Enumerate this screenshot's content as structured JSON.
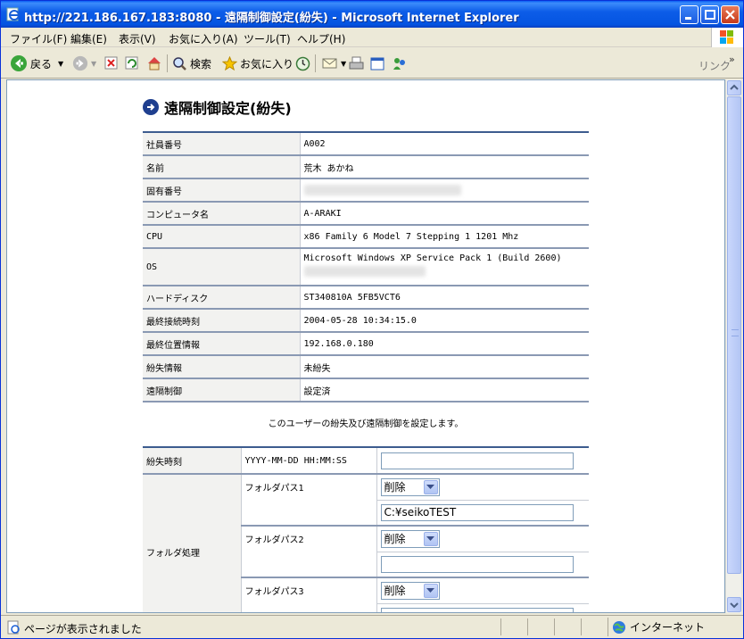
{
  "window": {
    "title": "http://221.186.167.183:8080 - 遠隔制御設定(紛失) - Microsoft Internet Explorer"
  },
  "menu": {
    "items": [
      "ファイル(F)",
      "編集(E)",
      "表示(V)",
      "お気に入り(A)",
      "ツール(T)",
      "ヘルプ(H)"
    ]
  },
  "toolbar": {
    "back_label": "戻る",
    "search_label": "検索",
    "favorites_label": "お気に入り",
    "links_label": "リンク",
    "chevron": "»"
  },
  "page": {
    "title": "遠隔制御設定(紛失)",
    "info_rows": [
      {
        "label": "社員番号",
        "value": "A002"
      },
      {
        "label": "名前",
        "value": "荒木 あかね"
      },
      {
        "label": "固有番号",
        "value": ""
      },
      {
        "label": "コンピュータ名",
        "value": "A-ARAKI"
      },
      {
        "label": "CPU",
        "value": "x86 Family 6 Model 7 Stepping 1 1201 Mhz"
      },
      {
        "label": "OS",
        "value": "Microsoft Windows XP Service Pack 1 (Build 2600)"
      },
      {
        "label": "ハードディスク",
        "value": "ST340810A 5FB5VCT6"
      },
      {
        "label": "最終接続時刻",
        "value": "2004-05-28 10:34:15.0"
      },
      {
        "label": "最終位置情報",
        "value": "192.168.0.180"
      },
      {
        "label": "紛失情報",
        "value": "未紛失"
      },
      {
        "label": "遠隔制御",
        "value": "設定済"
      }
    ],
    "notice": "このユーザーの紛失及び遠隔制御を設定します。",
    "lost_time": {
      "label": "紛失時刻",
      "format": "YYYY-MM-DD HH:MM:SS",
      "value": ""
    },
    "folder": {
      "label": "フォルダ処理",
      "paths": [
        {
          "label": "フォルダパス1",
          "action": "削除",
          "path": "C:¥seikoTEST"
        },
        {
          "label": "フォルダパス2",
          "action": "削除",
          "path": ""
        },
        {
          "label": "フォルダパス3",
          "action": "削除",
          "path": ""
        }
      ]
    }
  },
  "status": {
    "text": "ページが表示されました",
    "zone": "インターネット"
  }
}
